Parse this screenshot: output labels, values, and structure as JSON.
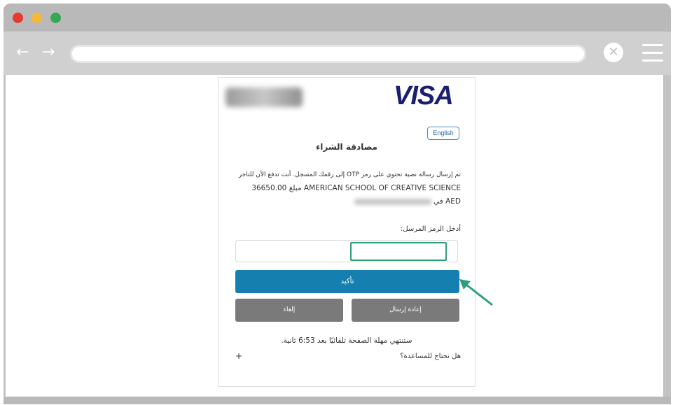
{
  "browser": {
    "dots": [
      "#e8392f",
      "#f5b93a",
      "#34a853"
    ],
    "back_glyph": "←",
    "forward_glyph": "→",
    "close_glyph": "✕",
    "icons": [
      "back-arrow-icon",
      "forward-arrow-icon",
      "close-icon",
      "menu-icon"
    ]
  },
  "page": {
    "language_button": "English",
    "title": "مصادقة الشراء",
    "message_line1": "تم إرسال رسالة نصية تحتوي على رمز OTP إلى رقمك المسجل. أنت تدفع الآن للتاجر",
    "message_line2": "AMERICAN SCHOOL OF CREATIVE SCIENCE مبلغ 36650.00",
    "message_line3": "AED في",
    "enter_code_label": "أدخل الرمز المرسل:",
    "confirm_button": "تأكيد",
    "resend_button": "إعادة إرسال",
    "cancel_button": "إلغاء",
    "timer_text": "ستنتهي مهلة الصفحة تلقائيًا بعد 6:53 ثانية.",
    "help_text": "هل تحتاج للمساعدة؟",
    "help_expand": "+",
    "brand_logo": "VISA",
    "colors": {
      "visa_blue": "#1a1f71",
      "confirm_blue": "#1580b0",
      "grey_button": "#7a7a7a",
      "highlight_green": "#2e9e7a"
    }
  }
}
